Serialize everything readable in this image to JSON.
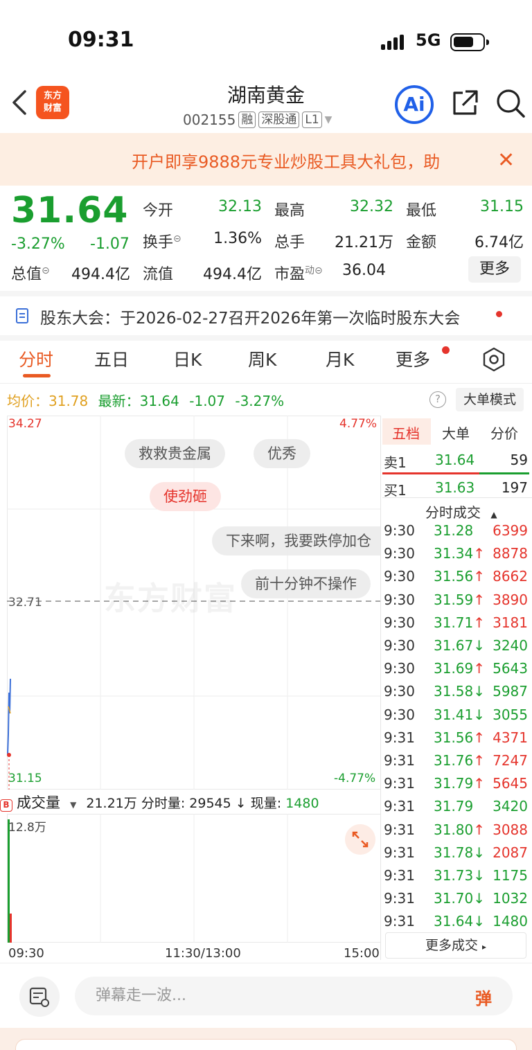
{
  "status": {
    "time": "09:31",
    "network": "5G"
  },
  "header": {
    "logo": "东方财富",
    "stock_name": "湖南黄金",
    "code": "002155",
    "tags": [
      "融",
      "深股通",
      "L1"
    ]
  },
  "banner": {
    "text": "开户即享9888元专业炒股工具大礼包，助"
  },
  "quote": {
    "price": "31.64",
    "pct": "-3.27%",
    "chg": "-1.07",
    "open_label": "今开",
    "open": "32.13",
    "high_label": "最高",
    "high": "32.32",
    "low_label": "最低",
    "low": "31.15",
    "turnover_label": "换手",
    "turnover": "1.36%",
    "volume_label": "总手",
    "volume": "21.21万",
    "amount_label": "金额",
    "amount": "6.74亿",
    "mktcap_label": "总值",
    "mktcap": "494.4亿",
    "float_label": "流值",
    "float": "494.4亿",
    "pe_label": "市盈",
    "pe_sup": "动",
    "pe": "36.04",
    "more": "更多"
  },
  "announcement": {
    "text": "股东大会：于2026-02-27召开2026年第一次临时股东大会"
  },
  "tabs": [
    "分时",
    "五日",
    "日K",
    "周K",
    "月K",
    "更多"
  ],
  "avg_row": {
    "avg_label": "均价：",
    "avg": "31.78",
    "last_label": "最新：",
    "last": "31.64",
    "chg": "-1.07",
    "pct": "-3.27%",
    "help": "?",
    "big_order": "大单模式"
  },
  "chart": {
    "y_top": "34.27",
    "y_mid": "32.71",
    "y_bottom": "31.15",
    "pct_top": "4.77%",
    "pct_bottom": "-4.77%",
    "watermark": "东方财富",
    "danmu": [
      "救救贵金属",
      "优秀",
      "使劲砸",
      "下来啊，我要跌停加仓",
      "前十分钟不操作"
    ]
  },
  "volume": {
    "label": "成交量",
    "total": "21.21万",
    "fenshi_label": "分时量:",
    "fenshi": "29545",
    "now_label": "现量:",
    "now": "1480",
    "max": "12.8万"
  },
  "time_axis": {
    "start": "09:30",
    "mid": "11:30/13:00",
    "end": "15:00"
  },
  "right_panel": {
    "tabs": [
      "五档",
      "大单",
      "分价"
    ],
    "sell1": {
      "label": "卖1",
      "price": "31.64",
      "vol": "59"
    },
    "buy1": {
      "label": "买1",
      "price": "31.63",
      "vol": "197"
    },
    "trades_title": "分时成交",
    "trades": [
      {
        "time": "9:30",
        "price": "31.28",
        "arrow": "",
        "vol": "6399",
        "vol_color": "red"
      },
      {
        "time": "9:30",
        "price": "31.34",
        "arrow": "↑",
        "vol": "8878",
        "vol_color": "red"
      },
      {
        "time": "9:30",
        "price": "31.56",
        "arrow": "↑",
        "vol": "8662",
        "vol_color": "red"
      },
      {
        "time": "9:30",
        "price": "31.59",
        "arrow": "↑",
        "vol": "3890",
        "vol_color": "red"
      },
      {
        "time": "9:30",
        "price": "31.71",
        "arrow": "↑",
        "vol": "3181",
        "vol_color": "red"
      },
      {
        "time": "9:30",
        "price": "31.67",
        "arrow": "↓",
        "vol": "3240",
        "vol_color": "green"
      },
      {
        "time": "9:30",
        "price": "31.69",
        "arrow": "↑",
        "vol": "5643",
        "vol_color": "green"
      },
      {
        "time": "9:30",
        "price": "31.58",
        "arrow": "↓",
        "vol": "5987",
        "vol_color": "green"
      },
      {
        "time": "9:30",
        "price": "31.41",
        "arrow": "↓",
        "vol": "3055",
        "vol_color": "green"
      },
      {
        "time": "9:31",
        "price": "31.56",
        "arrow": "↑",
        "vol": "4371",
        "vol_color": "red"
      },
      {
        "time": "9:31",
        "price": "31.76",
        "arrow": "↑",
        "vol": "7247",
        "vol_color": "red"
      },
      {
        "time": "9:31",
        "price": "31.79",
        "arrow": "↑",
        "vol": "5645",
        "vol_color": "red"
      },
      {
        "time": "9:31",
        "price": "31.79",
        "arrow": "",
        "vol": "3420",
        "vol_color": "green"
      },
      {
        "time": "9:31",
        "price": "31.80",
        "arrow": "↑",
        "vol": "3088",
        "vol_color": "red"
      },
      {
        "time": "9:31",
        "price": "31.78",
        "arrow": "↓",
        "vol": "2087",
        "vol_color": "red"
      },
      {
        "time": "9:31",
        "price": "31.73",
        "arrow": "↓",
        "vol": "1175",
        "vol_color": "green"
      },
      {
        "time": "9:31",
        "price": "31.70",
        "arrow": "↓",
        "vol": "1032",
        "vol_color": "green"
      },
      {
        "time": "9:31",
        "price": "31.64",
        "arrow": "↓",
        "vol": "1480",
        "vol_color": "green"
      }
    ],
    "more_trades": "更多成交"
  },
  "bottom": {
    "placeholder": "弹幕走一波...",
    "send": "弹"
  },
  "colors": {
    "up": "#e5342c",
    "down": "#1a9e2f",
    "accent": "#e95a23"
  }
}
